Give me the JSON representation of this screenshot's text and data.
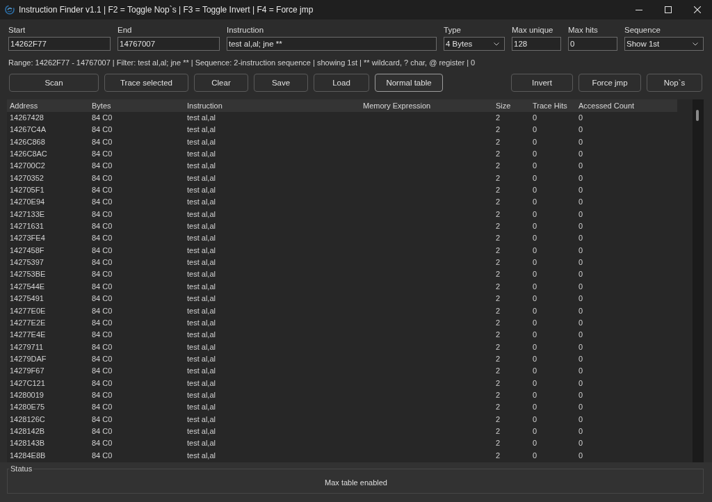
{
  "window": {
    "title": "Instruction Finder v1.1 | F2 = Toggle Nop`s | F3 = Toggle Invert | F4 = Force jmp"
  },
  "fields": [
    {
      "kind": "text",
      "label": "Start",
      "value": "14262F77"
    },
    {
      "kind": "text",
      "label": "End",
      "value": "14767007"
    },
    {
      "kind": "text",
      "label": "Instruction",
      "value": "test al,al; jne **"
    },
    {
      "kind": "dropdown",
      "label": "Type",
      "value": "4 Bytes"
    },
    {
      "kind": "text",
      "label": "Max unique",
      "value": "128"
    },
    {
      "kind": "text",
      "label": "Max hits",
      "value": "0"
    },
    {
      "kind": "dropdown",
      "label": "Sequence",
      "value": "Show 1st"
    }
  ],
  "summary": "Range: 14262F77 - 14767007 | Filter: test al,al; jne ** | Sequence: 2-instruction sequence | showing 1st | ** wildcard, ? char, @ register | 0",
  "toolbar": {
    "left": [
      {
        "label": "Scan",
        "focused": false
      },
      {
        "label": "Trace selected",
        "focused": false
      },
      {
        "label": "Clear",
        "focused": false
      },
      {
        "label": "Save",
        "focused": false
      },
      {
        "label": "Load",
        "focused": false
      },
      {
        "label": "Normal table",
        "focused": true
      }
    ],
    "right": [
      {
        "label": "Invert",
        "focused": false
      },
      {
        "label": "Force jmp",
        "focused": false
      },
      {
        "label": "Nop`s",
        "focused": false
      }
    ]
  },
  "table": {
    "columns": [
      "Address",
      "Bytes",
      "Instruction",
      "Memory Expression",
      "Size",
      "Trace Hits",
      "Accessed Count"
    ],
    "rows": [
      {
        "address": "14267428",
        "bytes": "84 C0",
        "instruction": "test al,al",
        "size": "2",
        "trace_hits": "0",
        "accessed_count": "0"
      },
      {
        "address": "14267C4A",
        "bytes": "84 C0",
        "instruction": "test al,al",
        "size": "2",
        "trace_hits": "0",
        "accessed_count": "0"
      },
      {
        "address": "1426C868",
        "bytes": "84 C0",
        "instruction": "test al,al",
        "size": "2",
        "trace_hits": "0",
        "accessed_count": "0"
      },
      {
        "address": "1426C8AC",
        "bytes": "84 C0",
        "instruction": "test al,al",
        "size": "2",
        "trace_hits": "0",
        "accessed_count": "0"
      },
      {
        "address": "142700C2",
        "bytes": "84 C0",
        "instruction": "test al,al",
        "size": "2",
        "trace_hits": "0",
        "accessed_count": "0"
      },
      {
        "address": "14270352",
        "bytes": "84 C0",
        "instruction": "test al,al",
        "size": "2",
        "trace_hits": "0",
        "accessed_count": "0"
      },
      {
        "address": "142705F1",
        "bytes": "84 C0",
        "instruction": "test al,al",
        "size": "2",
        "trace_hits": "0",
        "accessed_count": "0"
      },
      {
        "address": "14270E94",
        "bytes": "84 C0",
        "instruction": "test al,al",
        "size": "2",
        "trace_hits": "0",
        "accessed_count": "0"
      },
      {
        "address": "1427133E",
        "bytes": "84 C0",
        "instruction": "test al,al",
        "size": "2",
        "trace_hits": "0",
        "accessed_count": "0"
      },
      {
        "address": "14271631",
        "bytes": "84 C0",
        "instruction": "test al,al",
        "size": "2",
        "trace_hits": "0",
        "accessed_count": "0"
      },
      {
        "address": "14273FE4",
        "bytes": "84 C0",
        "instruction": "test al,al",
        "size": "2",
        "trace_hits": "0",
        "accessed_count": "0"
      },
      {
        "address": "1427458F",
        "bytes": "84 C0",
        "instruction": "test al,al",
        "size": "2",
        "trace_hits": "0",
        "accessed_count": "0"
      },
      {
        "address": "14275397",
        "bytes": "84 C0",
        "instruction": "test al,al",
        "size": "2",
        "trace_hits": "0",
        "accessed_count": "0"
      },
      {
        "address": "142753BE",
        "bytes": "84 C0",
        "instruction": "test al,al",
        "size": "2",
        "trace_hits": "0",
        "accessed_count": "0"
      },
      {
        "address": "1427544E",
        "bytes": "84 C0",
        "instruction": "test al,al",
        "size": "2",
        "trace_hits": "0",
        "accessed_count": "0"
      },
      {
        "address": "14275491",
        "bytes": "84 C0",
        "instruction": "test al,al",
        "size": "2",
        "trace_hits": "0",
        "accessed_count": "0"
      },
      {
        "address": "14277E0E",
        "bytes": "84 C0",
        "instruction": "test al,al",
        "size": "2",
        "trace_hits": "0",
        "accessed_count": "0"
      },
      {
        "address": "14277E2E",
        "bytes": "84 C0",
        "instruction": "test al,al",
        "size": "2",
        "trace_hits": "0",
        "accessed_count": "0"
      },
      {
        "address": "14277E4E",
        "bytes": "84 C0",
        "instruction": "test al,al",
        "size": "2",
        "trace_hits": "0",
        "accessed_count": "0"
      },
      {
        "address": "14279711",
        "bytes": "84 C0",
        "instruction": "test al,al",
        "size": "2",
        "trace_hits": "0",
        "accessed_count": "0"
      },
      {
        "address": "14279DAF",
        "bytes": "84 C0",
        "instruction": "test al,al",
        "size": "2",
        "trace_hits": "0",
        "accessed_count": "0"
      },
      {
        "address": "14279F67",
        "bytes": "84 C0",
        "instruction": "test al,al",
        "size": "2",
        "trace_hits": "0",
        "accessed_count": "0"
      },
      {
        "address": "1427C121",
        "bytes": "84 C0",
        "instruction": "test al,al",
        "size": "2",
        "trace_hits": "0",
        "accessed_count": "0"
      },
      {
        "address": "14280019",
        "bytes": "84 C0",
        "instruction": "test al,al",
        "size": "2",
        "trace_hits": "0",
        "accessed_count": "0"
      },
      {
        "address": "14280E75",
        "bytes": "84 C0",
        "instruction": "test al,al",
        "size": "2",
        "trace_hits": "0",
        "accessed_count": "0"
      },
      {
        "address": "1428126C",
        "bytes": "84 C0",
        "instruction": "test al,al",
        "size": "2",
        "trace_hits": "0",
        "accessed_count": "0"
      },
      {
        "address": "1428142B",
        "bytes": "84 C0",
        "instruction": "test al,al",
        "size": "2",
        "trace_hits": "0",
        "accessed_count": "0"
      },
      {
        "address": "1428143B",
        "bytes": "84 C0",
        "instruction": "test al,al",
        "size": "2",
        "trace_hits": "0",
        "accessed_count": "0"
      },
      {
        "address": "14284E8B",
        "bytes": "84 C0",
        "instruction": "test al,al",
        "size": "2",
        "trace_hits": "0",
        "accessed_count": "0"
      }
    ]
  },
  "status_bar": {
    "label": "Status",
    "message": "Max table enabled"
  }
}
